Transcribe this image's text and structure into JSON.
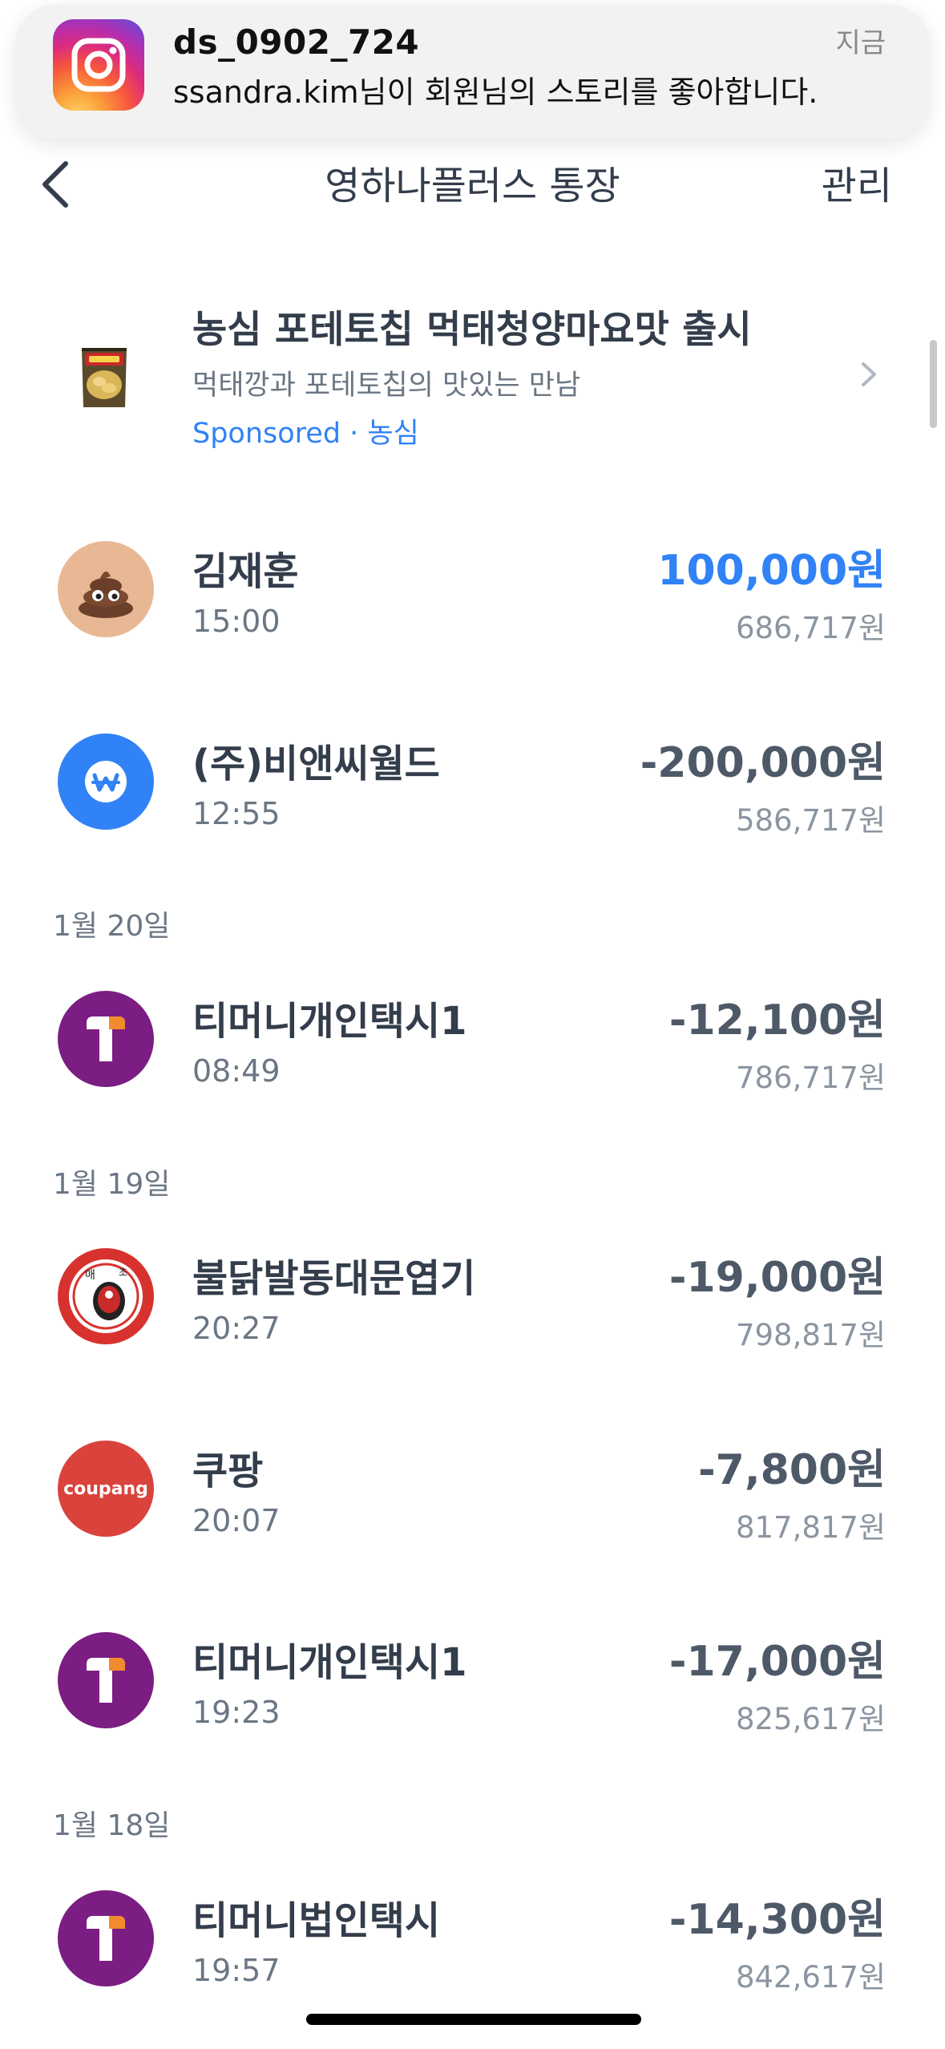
{
  "notification": {
    "app_icon": "instagram-icon",
    "title": "ds_0902_724",
    "time": "지금",
    "body": "ssandra.kim님이 회원님의 스토리를 좋아합니다."
  },
  "header": {
    "back_icon": "chevron-left-icon",
    "title": "영하나플러스 통장",
    "manage_label": "관리"
  },
  "ad": {
    "title": "농심 포테토칩 먹태청양마요맛 출시",
    "subtitle": "먹태깡과 포테토칩의 맛있는 만남",
    "sponsored": "Sponsored · 농심",
    "chevron_icon": "chevron-right-icon"
  },
  "dates": [
    "1월 20일",
    "1월 19일",
    "1월 18일"
  ],
  "transactions": [
    {
      "name": "김재훈",
      "time": "15:00",
      "amount": "100,000원",
      "balance": "686,717원",
      "icon": "poop-emoji-avatar",
      "color": "#e8b895"
    },
    {
      "name": "(주)비앤씨월드",
      "time": "12:55",
      "amount": "-200,000원",
      "balance": "586,717원",
      "icon": "won-icon",
      "color": "#3182f6"
    },
    {
      "name": "티머니개인택시1",
      "time": "08:49",
      "amount": "-12,100원",
      "balance": "786,717원",
      "icon": "tmoney-icon",
      "color": "#7b1d82"
    },
    {
      "name": "불닭발동대문엽기",
      "time": "20:27",
      "amount": "-19,000원",
      "balance": "798,817원",
      "icon": "restaurant-logo-icon",
      "color": "#d8322e"
    },
    {
      "name": "쿠팡",
      "time": "20:07",
      "amount": "-7,800원",
      "balance": "817,817원",
      "icon": "coupang-logo",
      "logo_text": "coupang",
      "color": "#d9433c"
    },
    {
      "name": "티머니개인택시1",
      "time": "19:23",
      "amount": "-17,000원",
      "balance": "825,617원",
      "icon": "tmoney-icon",
      "color": "#7b1d82"
    },
    {
      "name": "티머니법인택시",
      "time": "19:57",
      "amount": "-14,300원",
      "balance": "842,617원",
      "icon": "tmoney-icon",
      "color": "#7b1d82"
    }
  ]
}
